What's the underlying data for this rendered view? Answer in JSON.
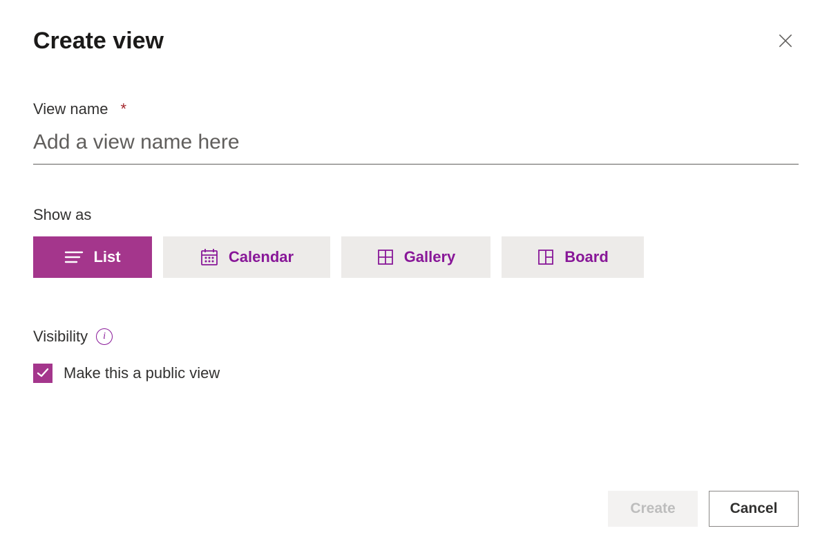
{
  "dialog": {
    "title": "Create view"
  },
  "view_name": {
    "label": "View name",
    "required_marker": "*",
    "placeholder": "Add a view name here",
    "value": ""
  },
  "show_as": {
    "label": "Show as",
    "options": [
      {
        "label": "List",
        "selected": true
      },
      {
        "label": "Calendar",
        "selected": false
      },
      {
        "label": "Gallery",
        "selected": false
      },
      {
        "label": "Board",
        "selected": false
      }
    ]
  },
  "visibility": {
    "label": "Visibility",
    "checkbox_label": "Make this a public view",
    "checked": true
  },
  "footer": {
    "create_label": "Create",
    "cancel_label": "Cancel",
    "create_enabled": false
  },
  "colors": {
    "accent": "#a4368c",
    "accent_fg": "#881798",
    "tile_bg": "#edebe9"
  }
}
